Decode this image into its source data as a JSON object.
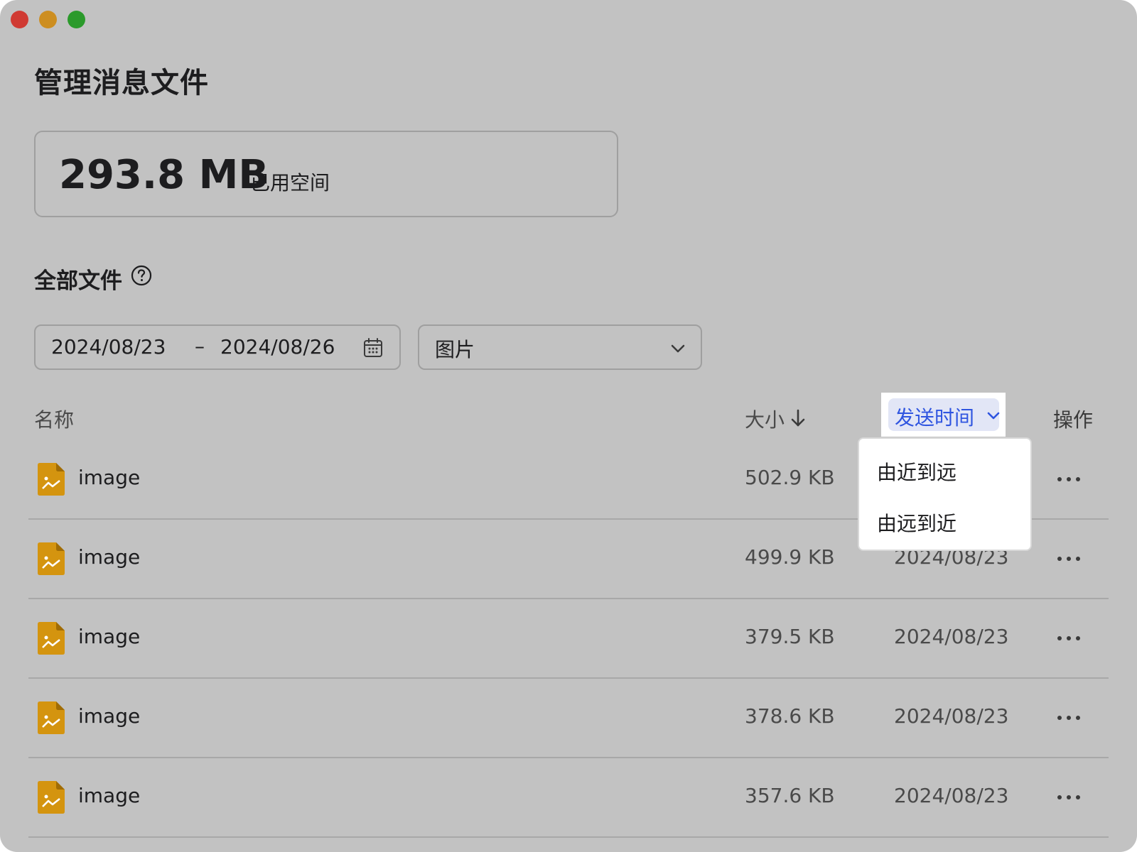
{
  "page": {
    "title": "管理消息文件"
  },
  "storage": {
    "value": "293.8 MB",
    "label": "已用空间"
  },
  "section": {
    "title": "全部文件",
    "help_icon": "question-circle-icon"
  },
  "filters": {
    "date_start": "2024/08/23",
    "date_separator": "–",
    "date_end": "2024/08/26",
    "calendar_icon": "calendar-icon",
    "type_selected": "图片",
    "type_icon": "chevron-down-icon"
  },
  "table": {
    "headers": {
      "name": "名称",
      "size": "大小",
      "size_sort_icon": "arrow-down-icon",
      "time": "发送时间",
      "action": "操作"
    },
    "rows": [
      {
        "name": "image",
        "size": "502.9 KB",
        "date": ""
      },
      {
        "name": "image",
        "size": "499.9 KB",
        "date": "2024/08/23"
      },
      {
        "name": "image",
        "size": "379.5 KB",
        "date": "2024/08/23"
      },
      {
        "name": "image",
        "size": "378.6 KB",
        "date": "2024/08/23"
      },
      {
        "name": "image",
        "size": "357.6 KB",
        "date": "2024/08/23"
      }
    ],
    "file_icon": "image-file-icon",
    "more_icon": "more-horizontal-icon"
  },
  "sort_menu": {
    "options": [
      "由近到远",
      "由远到近"
    ]
  },
  "colors": {
    "window_bg": "#c2c2c2",
    "accent": "#2f55e0",
    "file_icon": "#d4940f",
    "close": "#d03a33",
    "minimize": "#cd8e20",
    "maximize": "#2b9a2b"
  }
}
